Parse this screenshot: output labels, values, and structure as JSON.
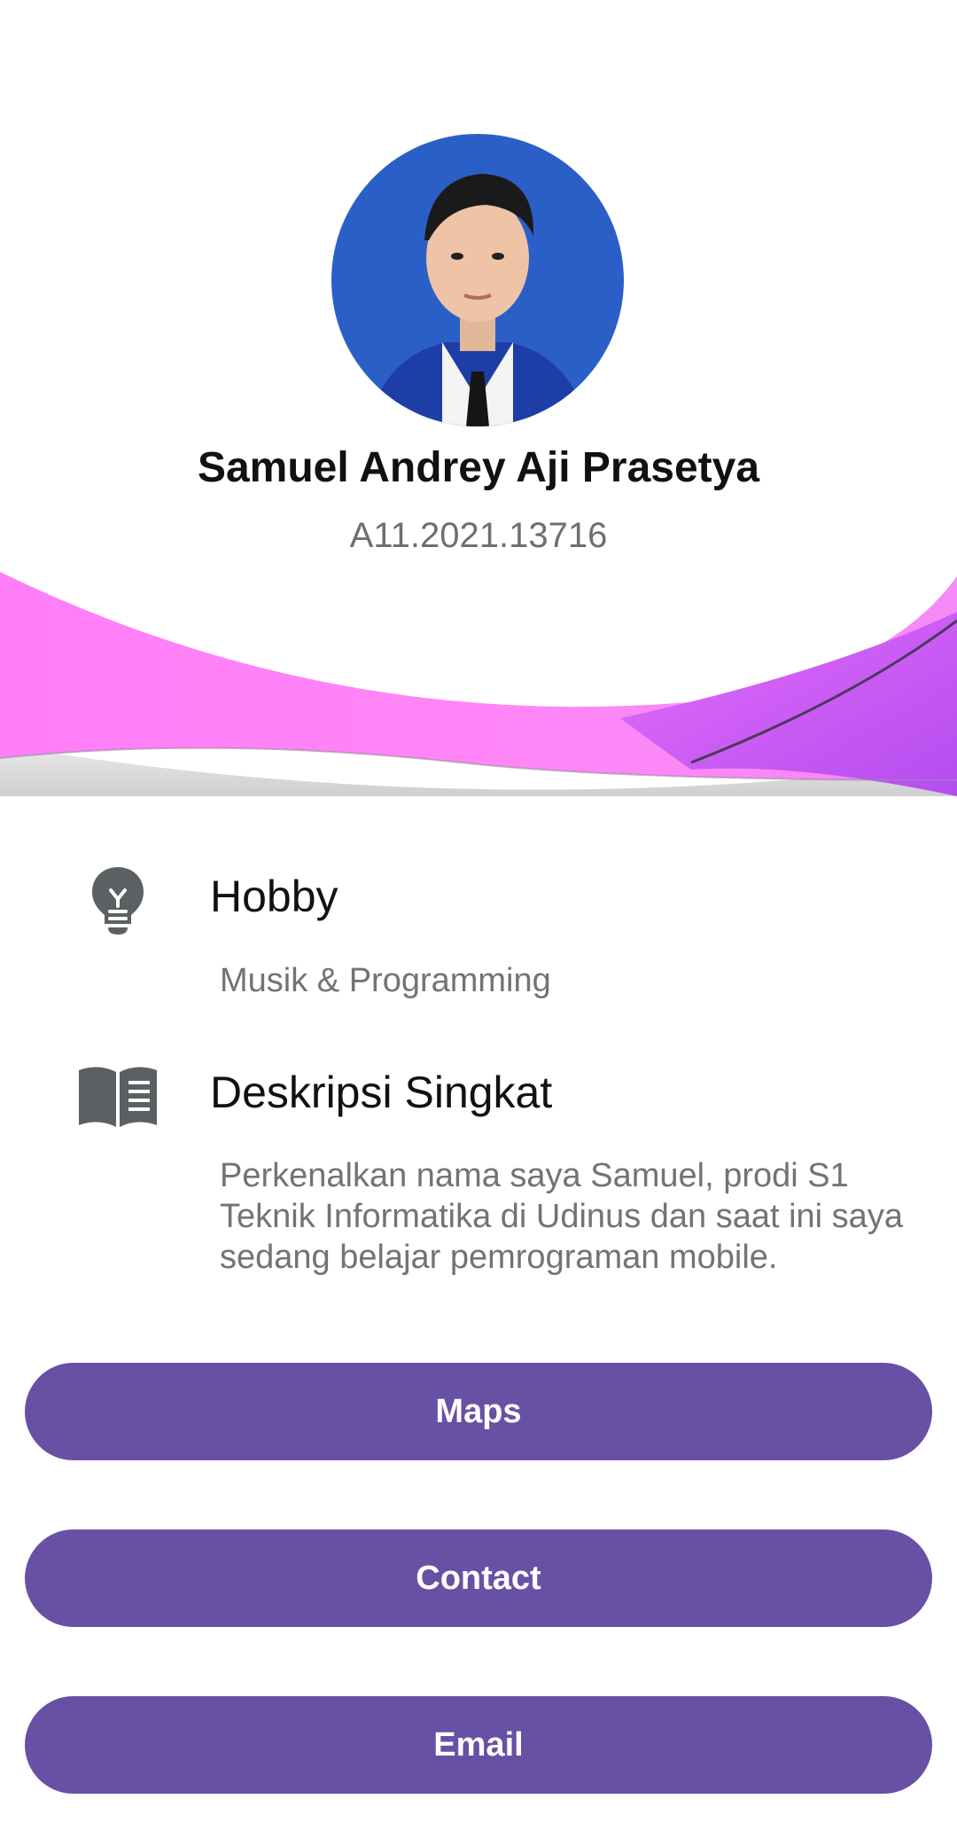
{
  "profile": {
    "name": "Samuel Andrey Aji Prasetya",
    "student_id": "A11.2021.13716"
  },
  "hobby": {
    "icon": "lightbulb-icon",
    "title": "Hobby",
    "text": "Musik & Programming"
  },
  "description": {
    "icon": "book-icon",
    "title": "Deskripsi Singkat",
    "text": "Perkenalkan nama saya Samuel, prodi S1 Teknik Informatika di Udinus dan saat ini saya sedang belajar pemrograman mobile."
  },
  "buttons": {
    "maps": "Maps",
    "contact": "Contact",
    "email": "Email"
  },
  "colors": {
    "accent": "#6850a4",
    "wave_pink": "#ff7ef8",
    "wave_purple": "#cc58f4",
    "icon_gray": "#5b6062"
  }
}
